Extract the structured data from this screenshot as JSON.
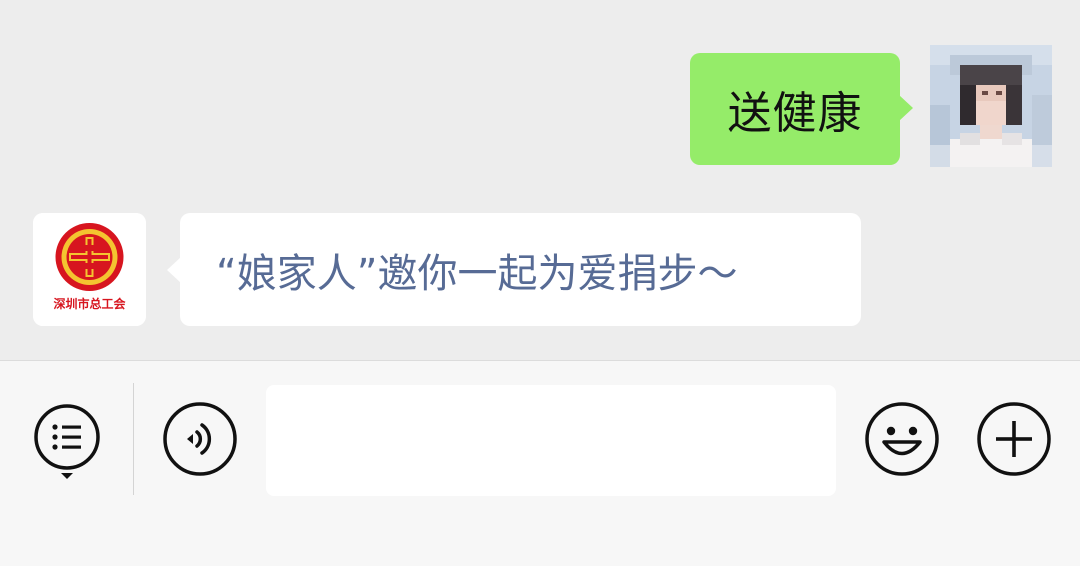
{
  "chat": {
    "outgoing_message": "送健康",
    "incoming_message": "“娘家人”邀你一起为爱捐步～",
    "sender_avatar_caption": "深圳市总工会"
  },
  "input_bar": {
    "text_value": "",
    "icons": {
      "menu": "menu-list-icon",
      "voice": "voice-icon",
      "emoji": "emoji-icon",
      "plus": "plus-icon"
    }
  },
  "colors": {
    "background": "#ededed",
    "outgoing_bubble": "#95ec69",
    "incoming_bubble": "#ffffff",
    "incoming_text": "#576b95",
    "union_logo_red": "#d7151f",
    "union_logo_gold": "#f4c430"
  }
}
